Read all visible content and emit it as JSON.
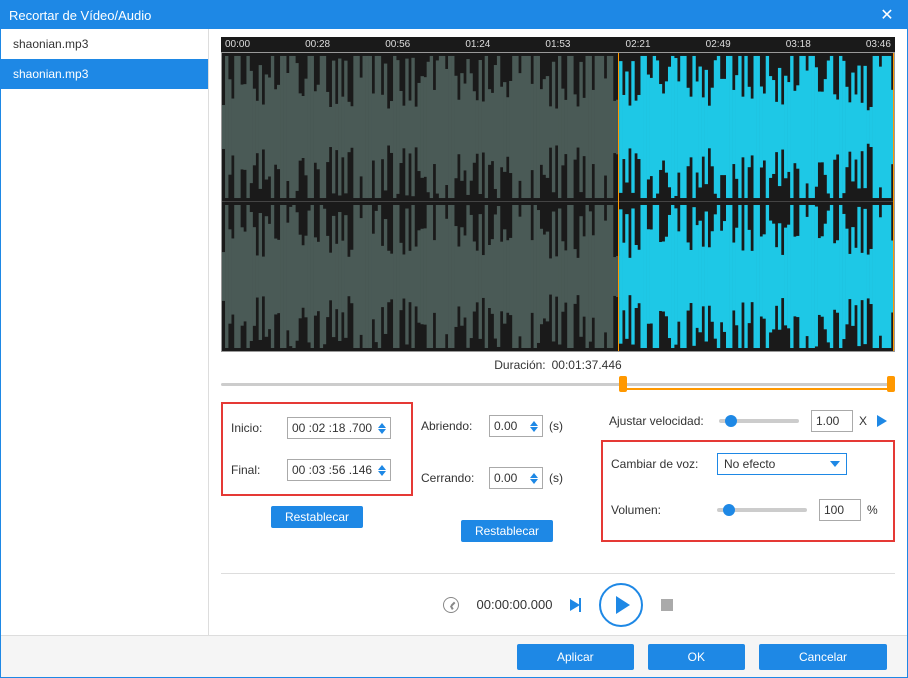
{
  "title": "Recortar de Vídeo/Audio",
  "sidebar": {
    "items": [
      {
        "label": "shaonian.mp3",
        "active": false
      },
      {
        "label": "shaonian.mp3",
        "active": true
      }
    ]
  },
  "timeline": {
    "ticks": [
      "00:00",
      "00:28",
      "00:56",
      "01:24",
      "01:53",
      "02:21",
      "02:49",
      "03:18",
      "03:46"
    ],
    "duration_label": "Duración:",
    "duration_value": "00:01:37.446",
    "selection_start_pct": 59,
    "selection_end_pct": 100
  },
  "trim": {
    "start_label": "Inicio:",
    "start_value": "00 :02 :18 .700",
    "end_label": "Final:",
    "end_value": "00 :03 :56 .146",
    "reset_label": "Restablecar"
  },
  "fade": {
    "open_label": "Abriendo:",
    "open_value": "0.00",
    "close_label": "Cerrando:",
    "close_value": "0.00",
    "unit": "(s)",
    "reset_label": "Restablecar"
  },
  "adjust": {
    "speed_label": "Ajustar velocidad:",
    "speed_value": "1.00",
    "speed_unit": "X",
    "voice_label": "Cambiar de voz:",
    "voice_value": "No efecto",
    "volume_label": "Volumen:",
    "volume_value": "100",
    "volume_unit": "%"
  },
  "playback": {
    "time": "00:00:00.000"
  },
  "footer": {
    "apply": "Aplicar",
    "ok": "OK",
    "cancel": "Cancelar"
  }
}
